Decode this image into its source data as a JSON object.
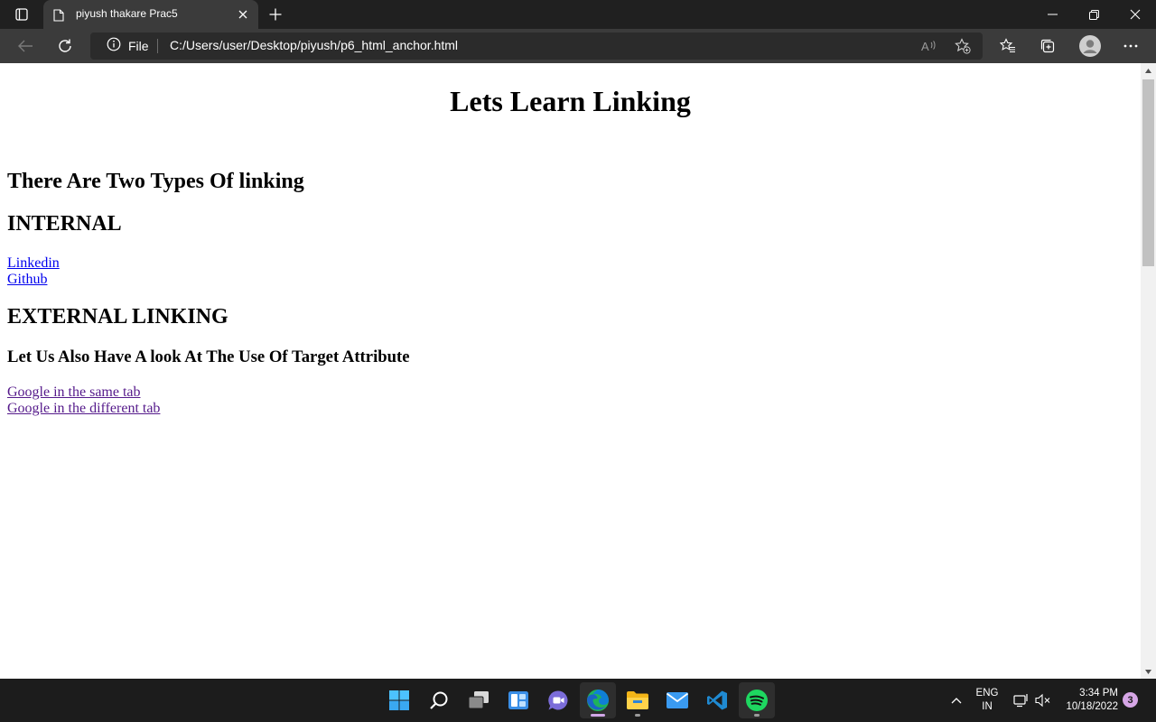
{
  "browser": {
    "tab": {
      "title": "piyush thakare Prac5"
    },
    "address_bar": {
      "site_info_label": "File",
      "url": "C:/Users/user/Desktop/piyush/p6_html_anchor.html"
    },
    "icons": {
      "tab_actions": "tab-actions-icon",
      "page": "page-icon",
      "close_tab": "close-icon",
      "new_tab": "plus-icon",
      "minimize": "minimize-icon",
      "restore": "restore-icon",
      "close_window": "close-icon",
      "back": "back-arrow-icon",
      "refresh": "refresh-icon",
      "info": "info-icon",
      "read_aloud": "read-aloud-icon",
      "add_favorite": "add-favorite-icon",
      "favorites": "favorites-icon",
      "collections": "collections-icon",
      "profile": "profile-avatar-icon",
      "more": "more-icon"
    },
    "colors": {
      "titlebar": "#202020",
      "toolbar": "#3b3b3b",
      "omnibox": "#2b2b2b"
    }
  },
  "page": {
    "heading": "Lets Learn Linking",
    "types_heading": "There Are Two Types Of linking",
    "internal_heading": "INTERNAL",
    "internal_links": [
      {
        "label": "Linkedin",
        "state": "unvisited"
      },
      {
        "label": "Github",
        "state": "unvisited"
      }
    ],
    "external_heading": "EXTERNAL LINKING",
    "target_heading": "Let Us Also Have A look At The Use Of Target Attribute",
    "target_links": [
      {
        "label": "Google in the same tab",
        "state": "visited"
      },
      {
        "label": "Google in the different tab",
        "state": "visited"
      }
    ],
    "colors": {
      "link": "#0000ee",
      "visited_link": "#551a8b"
    }
  },
  "taskbar": {
    "apps": [
      {
        "name": "start",
        "icon": "windows-start-icon"
      },
      {
        "name": "search",
        "icon": "search-icon"
      },
      {
        "name": "task-view",
        "icon": "task-view-icon"
      },
      {
        "name": "widgets",
        "icon": "widgets-icon"
      },
      {
        "name": "teams-chat",
        "icon": "chat-icon"
      },
      {
        "name": "edge",
        "icon": "edge-icon",
        "active": true
      },
      {
        "name": "file-explorer",
        "icon": "folder-icon",
        "running": true
      },
      {
        "name": "mail",
        "icon": "mail-icon"
      },
      {
        "name": "vscode",
        "icon": "vscode-icon"
      },
      {
        "name": "spotify",
        "icon": "spotify-icon",
        "running": true
      }
    ],
    "tray": {
      "language_line1": "ENG",
      "language_line2": "IN",
      "time": "3:34 PM",
      "date": "10/18/2022",
      "notification_count": "3"
    },
    "colors": {
      "background": "#1c1c1c",
      "badge": "#d6a6e6"
    }
  }
}
